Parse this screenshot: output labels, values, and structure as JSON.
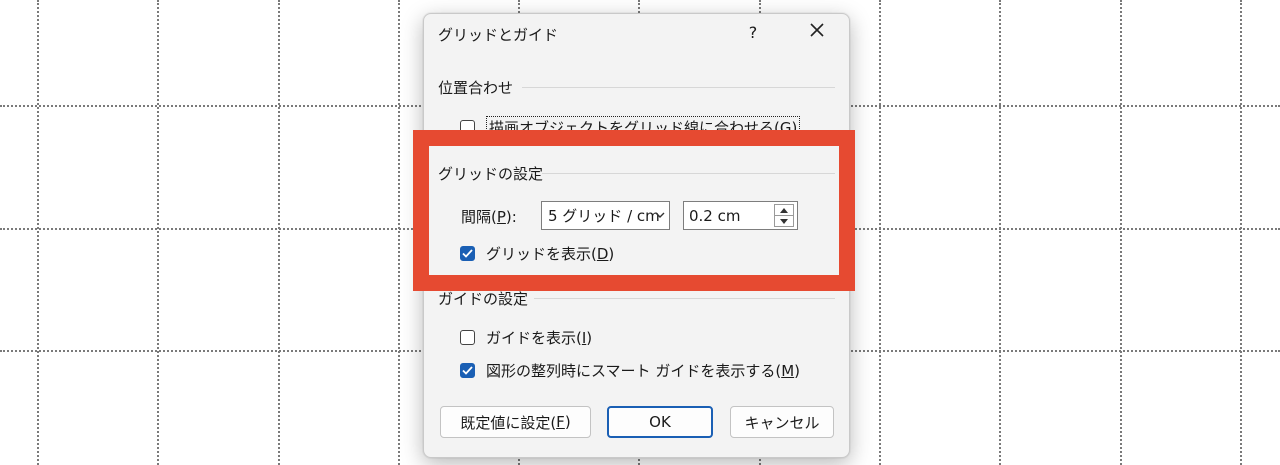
{
  "dialog": {
    "title": "グリッドとガイド",
    "help_label": "?",
    "close_icon": "close-icon"
  },
  "align_section": {
    "label": "位置合わせ",
    "snap_checkbox": {
      "label_pre": "描画オブジェクトをグリッド線に合わせる(",
      "accel": "G",
      "label_post": ")",
      "checked": false
    }
  },
  "grid_section": {
    "label": "グリッドの設定",
    "spacing_label_pre": "間隔(",
    "spacing_accel": "P",
    "spacing_label_post": "):",
    "spacing_select_value": "5 グリッド / cm",
    "spacing_value": "0.2 cm",
    "show_grid": {
      "label_pre": "グリッドを表示(",
      "accel": "D",
      "label_post": ")",
      "checked": true
    }
  },
  "guide_section": {
    "label": "ガイドの設定",
    "show_guides": {
      "label_pre": "ガイドを表示(",
      "accel": "I",
      "label_post": ")",
      "checked": false
    },
    "smart_guides": {
      "label_pre": "図形の整列時にスマート ガイドを表示する(",
      "accel": "M",
      "label_post": ")",
      "checked": true
    }
  },
  "buttons": {
    "set_default_pre": "既定値に設定(",
    "set_default_accel": "F",
    "set_default_post": ")",
    "ok": "OK",
    "cancel": "キャンセル"
  },
  "colors": {
    "highlight": "#e64a31",
    "accent": "#1a5fb4",
    "dialog_bg": "#f3f3f3"
  }
}
